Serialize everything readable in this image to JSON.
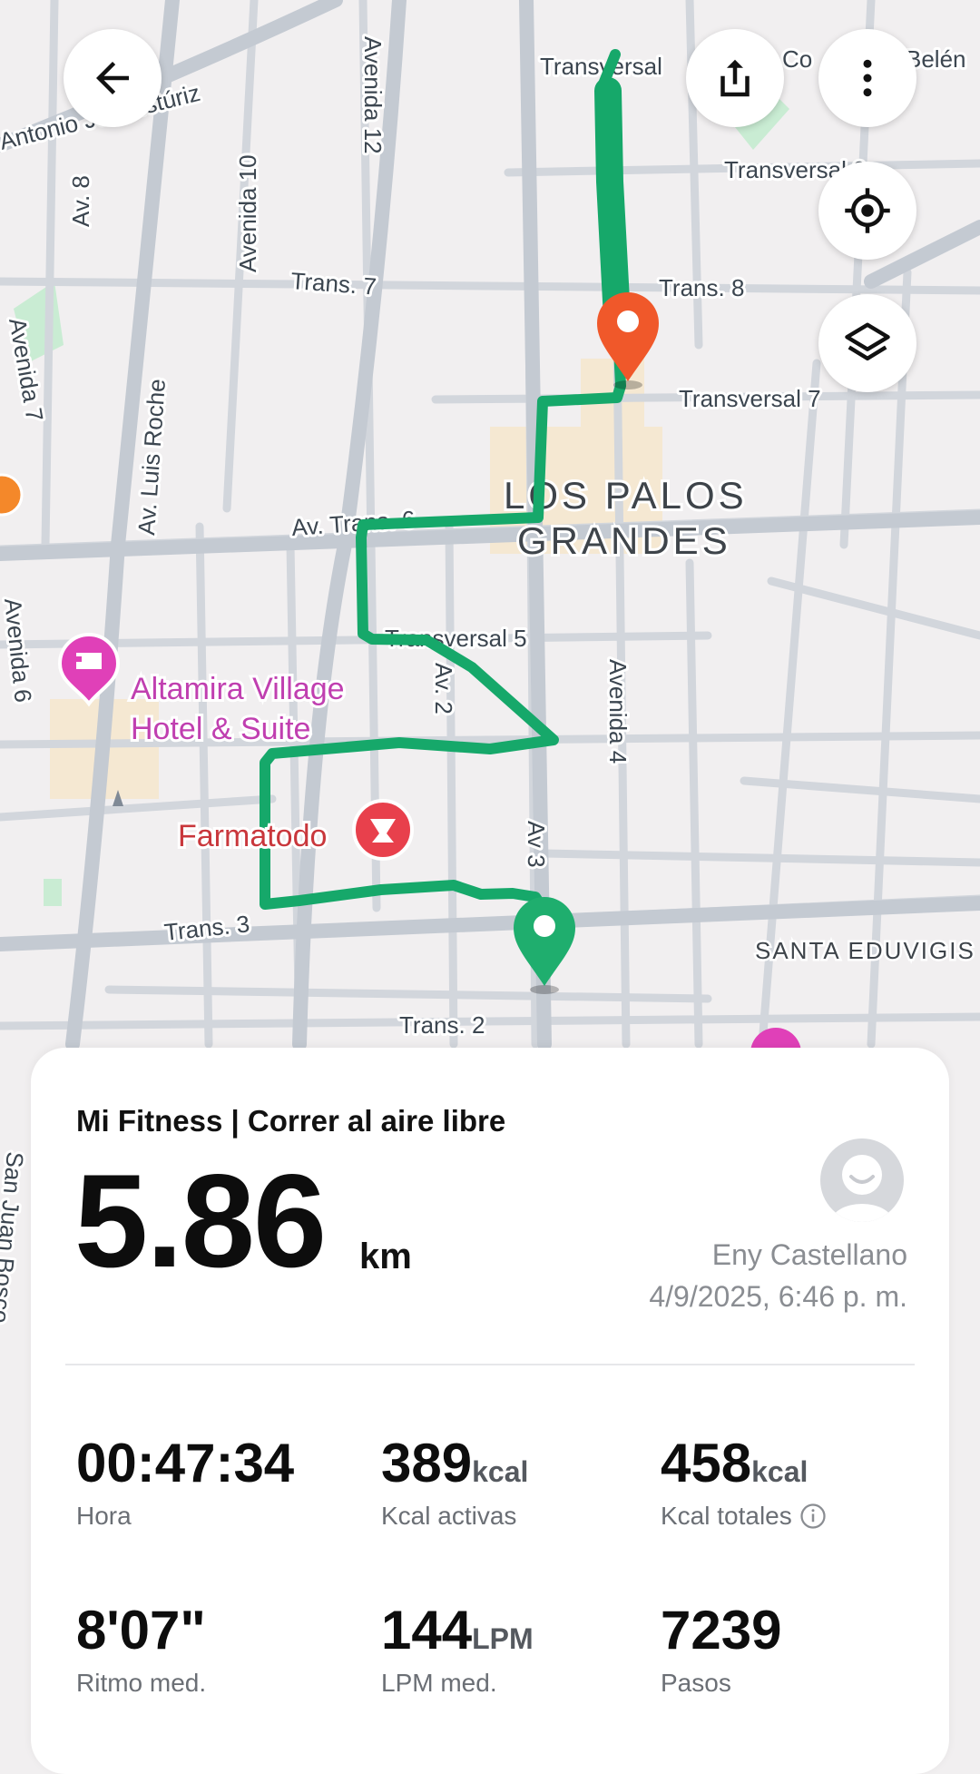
{
  "map": {
    "roads": {
      "antonio_jose_isturiz": "Antonio José Istúriz",
      "av8": "Av. 8",
      "avenida10": "Avenida 10",
      "avenida12": "Avenida 12",
      "transversal_top": "Transversal",
      "colinas": "Co",
      "belen": "Belén",
      "transversal9": "Transversal 9",
      "trans7": "Trans. 7",
      "trans8": "Trans. 8",
      "avenida7": "Avenida 7",
      "av_luis_roche": "Av. Luis Roche",
      "transversal7": "Transversal 7",
      "av_trans6": "Av. Trans. 6",
      "transversal5": "Transversal 5",
      "av2": "Av. 2",
      "avenida4": "Avenida 4",
      "avenida6": "Avenida 6",
      "av3": "Av 3",
      "trans3": "Trans. 3",
      "trans2": "Trans. 2",
      "san_juan_bosco": "San Juan Bosco"
    },
    "areas": {
      "los_palos_1": "LOS PALOS",
      "los_palos_2": "GRANDES",
      "santa_eduvigis": "SANTA EDUVIGIS"
    },
    "pois": {
      "hotel_line1": "Altamira Village",
      "hotel_line2": "Hotel & Suite",
      "farmatodo": "Farmatodo"
    },
    "colors": {
      "route": "#16a86a",
      "start_pin": "#1fae6e",
      "end_pin": "#f0582a",
      "hotel": "#e040b8",
      "farmatodo": "#e8404c"
    }
  },
  "controls": {
    "back": "arrow-left-icon",
    "share": "share-icon",
    "more": "more-vertical-icon",
    "locate": "locate-icon",
    "layers": "layers-icon"
  },
  "workout": {
    "title": "Mi Fitness | Correr al aire libre",
    "distance": "5.86",
    "distance_unit": "km",
    "user": "Eny Castellano",
    "date": "4/9/2025, 6:46 p. m.",
    "stats": {
      "time": {
        "value": "00:47:34",
        "label": "Hora"
      },
      "active_kcal": {
        "value": "389",
        "unit": "kcal",
        "label": "Kcal activas"
      },
      "total_kcal": {
        "value": "458",
        "unit": "kcal",
        "label": "Kcal totales"
      },
      "pace": {
        "value": "8'07\"",
        "label": "Ritmo med."
      },
      "hr": {
        "value": "144",
        "unit": "LPM",
        "label": "LPM med."
      },
      "steps": {
        "value": "7239",
        "label": "Pasos"
      }
    }
  }
}
